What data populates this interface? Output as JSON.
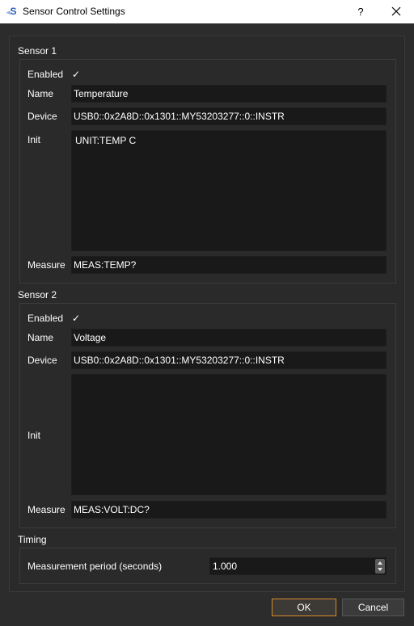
{
  "window": {
    "title": "Sensor Control Settings",
    "help_glyph": "?",
    "app_icon": "S"
  },
  "sensor1": {
    "title": "Sensor 1",
    "enabled_label": "Enabled",
    "enabled": true,
    "checkmark": "✓",
    "name_label": "Name",
    "name_value": "Temperature",
    "device_label": "Device",
    "device_value": "USB0::0x2A8D::0x1301::MY53203277::0::INSTR",
    "init_label": "Init",
    "init_value": "UNIT:TEMP C",
    "measure_label": "Measure",
    "measure_value": "MEAS:TEMP?"
  },
  "sensor2": {
    "title": "Sensor 2",
    "enabled_label": "Enabled",
    "enabled": true,
    "checkmark": "✓",
    "name_label": "Name",
    "name_value": "Voltage",
    "device_label": "Device",
    "device_value": "USB0::0x2A8D::0x1301::MY53203277::0::INSTR",
    "init_label": "Init",
    "init_value": "",
    "measure_label": "Measure",
    "measure_value": "MEAS:VOLT:DC?"
  },
  "timing": {
    "title": "Timing",
    "period_label": "Measurement period (seconds)",
    "period_value": "1.000"
  },
  "buttons": {
    "ok_label": "OK",
    "cancel_label": "Cancel"
  },
  "colors": {
    "background": "#2c2c2c",
    "field_background": "#191919",
    "ok_border": "#d78b2d"
  }
}
